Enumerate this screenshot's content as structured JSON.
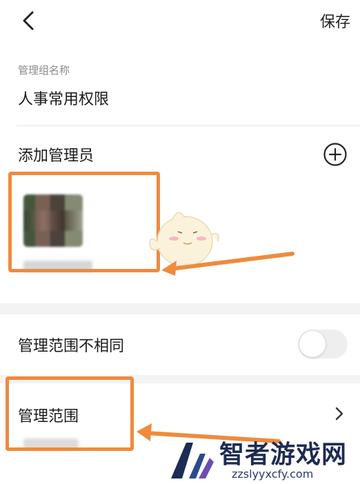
{
  "header": {
    "save_label": "保存"
  },
  "group": {
    "label": "管理组名称",
    "value": "人事常用权限"
  },
  "admins": {
    "label": "添加管理员"
  },
  "scope_diff": {
    "label": "管理范围不相同",
    "enabled": false
  },
  "scope": {
    "label": "管理范围"
  },
  "watermark": {
    "brand": "智者游戏网",
    "url": "zzslyyxcfy.com"
  },
  "colors": {
    "highlight": "#f08a3c",
    "watermark": "#1c2c52"
  },
  "icons": {
    "back": "chevron-left-icon",
    "add": "plus-circle-icon",
    "forward": "chevron-right-icon"
  }
}
